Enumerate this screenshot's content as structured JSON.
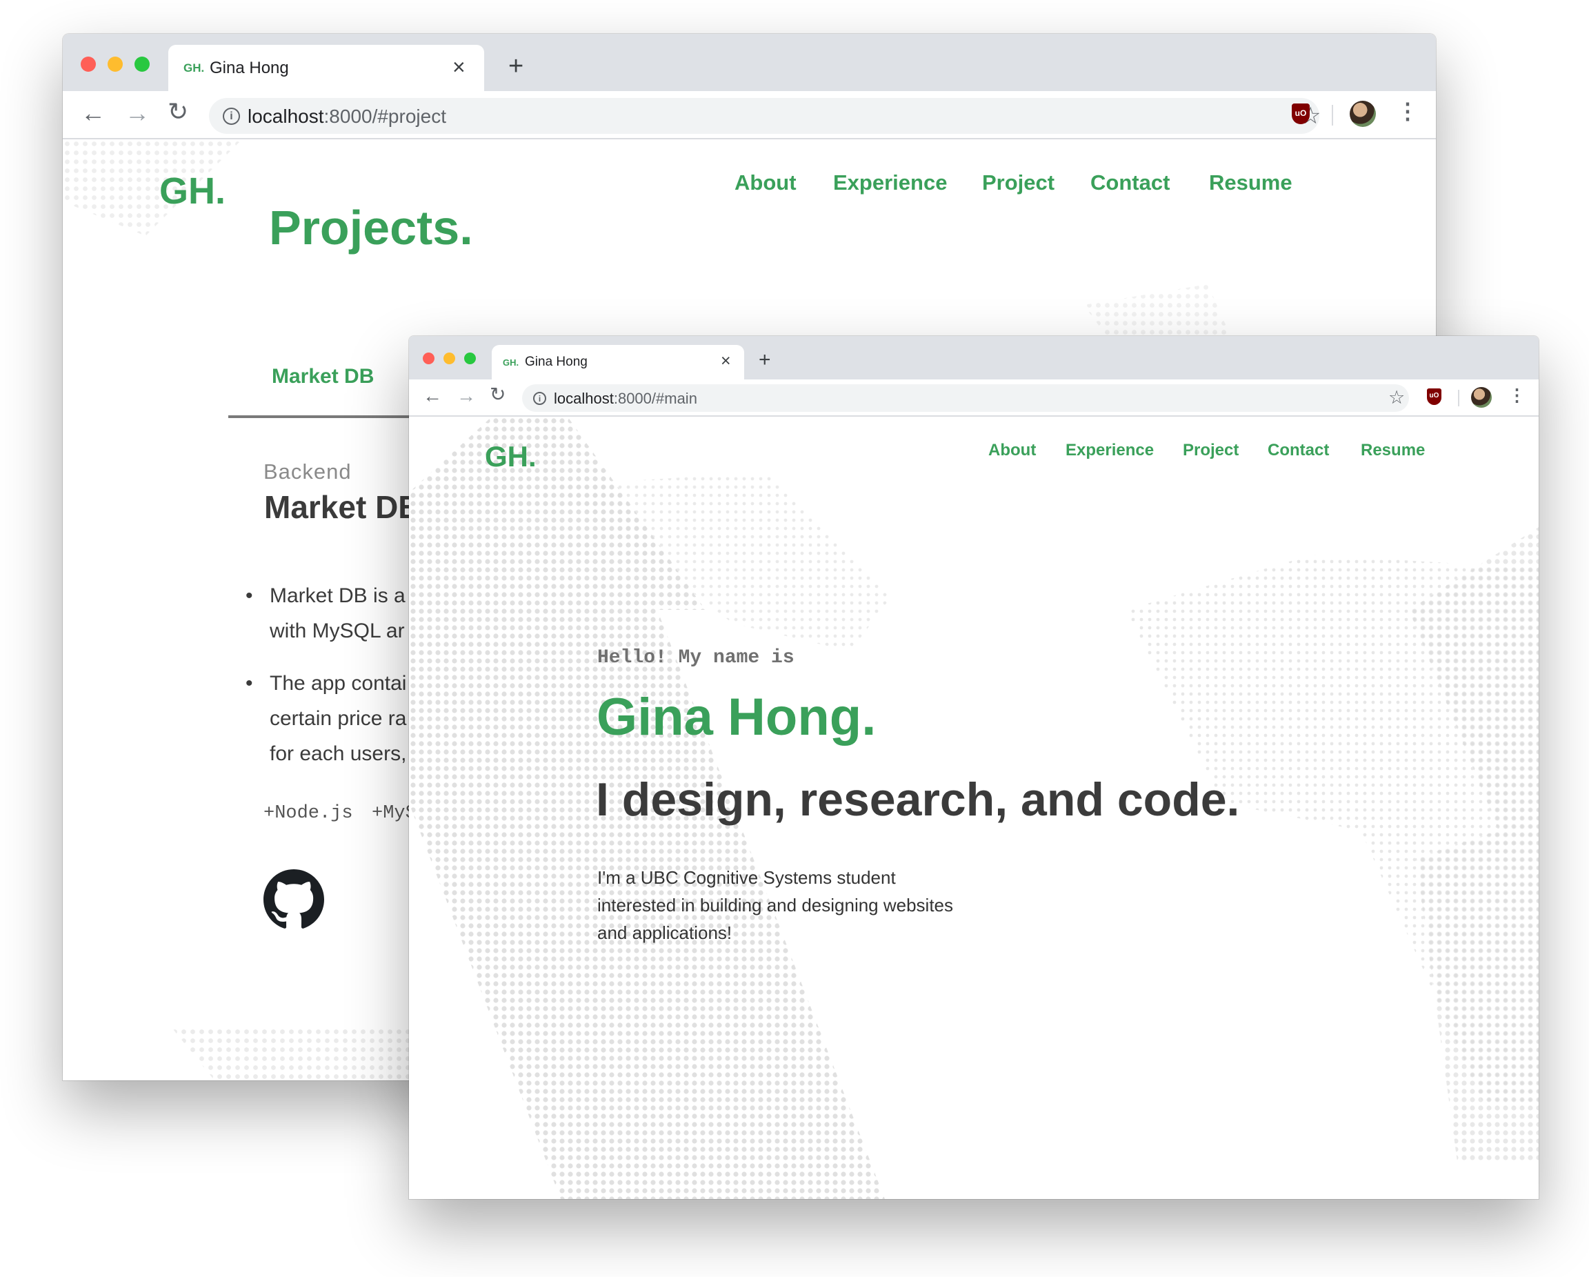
{
  "back_window": {
    "tab": {
      "favicon": "GH.",
      "title": "Gina Hong",
      "close": "×"
    },
    "new_tab": "+",
    "address": {
      "host": "localhost",
      "path": ":8000/#project"
    },
    "page": {
      "logo": "GH.",
      "nav": [
        "About",
        "Experience",
        "Project",
        "Contact",
        "Resume"
      ],
      "heading": "Projects.",
      "project_tab": "Market DB",
      "category": "Backend",
      "project_title": "Market DB",
      "bullets": [
        [
          "Market DB is a",
          "with MySQL ar"
        ],
        [
          "The app contai",
          "certain price ra",
          "for each users,"
        ]
      ],
      "tags": [
        "+Node.js",
        "+MyS"
      ]
    }
  },
  "front_window": {
    "tab": {
      "favicon": "GH.",
      "title": "Gina Hong",
      "close": "×"
    },
    "new_tab": "+",
    "address": {
      "host": "localhost",
      "path": ":8000/#main"
    },
    "page": {
      "logo": "GH.",
      "nav": [
        "About",
        "Experience",
        "Project",
        "Contact",
        "Resume"
      ],
      "greeting": "Hello! My name is",
      "name": "Gina Hong.",
      "tagline": "I design, research, and code.",
      "bio": [
        "I'm a UBC Cognitive Systems student",
        "interested in building and designing websites",
        "and applications!"
      ]
    }
  },
  "icons": {
    "back": "arrow-left-icon",
    "forward": "arrow-right-icon",
    "reload": "reload-icon",
    "info": "info-icon",
    "bookmark": "star-icon",
    "extension": "ublock-shield-icon",
    "profile": "avatar",
    "menu": "kebab-menu-icon",
    "github": "github-icon"
  },
  "colors": {
    "accent_green": "#3aa05a",
    "text_dark": "#3b3b3b",
    "tabstrip": "#dee1e6",
    "omnibox": "#f1f3f4",
    "traffic_red": "#ff5f57",
    "traffic_yellow": "#febc2e",
    "traffic_green": "#28c840"
  }
}
